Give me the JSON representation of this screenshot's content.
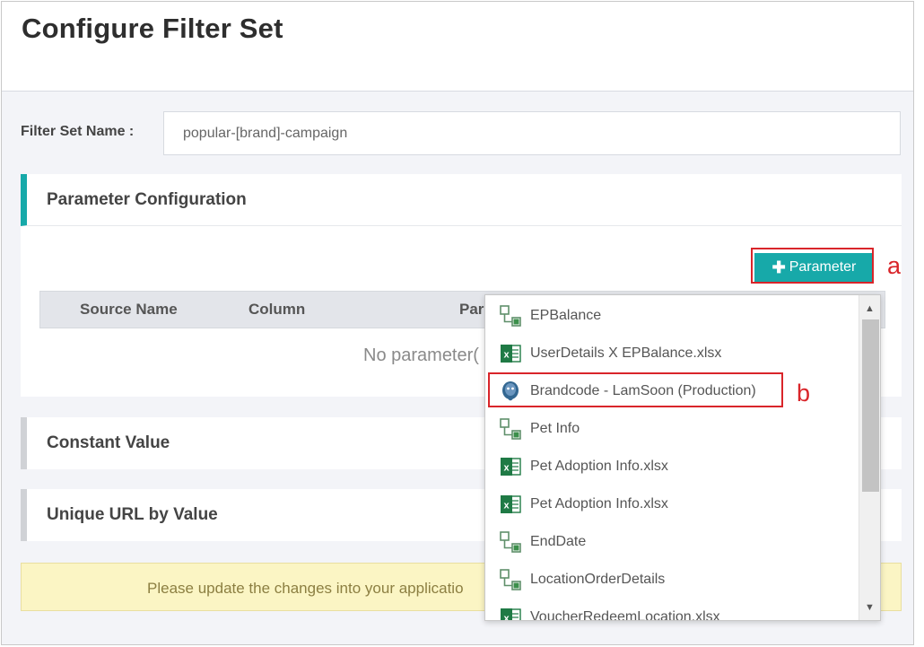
{
  "page": {
    "title": "Configure Filter Set"
  },
  "filter_set": {
    "label": "Filter Set Name :",
    "value": "popular-[brand]-campaign"
  },
  "parameter_config": {
    "title": "Parameter Configuration",
    "add_button_label": "Parameter",
    "columns": [
      "Source Name",
      "Column",
      "Par"
    ],
    "empty_text": "No parameter("
  },
  "constant_value": {
    "title": "Constant Value"
  },
  "unique_url": {
    "title": "Unique URL by Value"
  },
  "notice": {
    "text": "Please update the changes into your applicatio"
  },
  "annotations": {
    "a": "a",
    "b": "b",
    "color": "#d9252a"
  },
  "theme": {
    "accent": "#17a9a9",
    "notice_bg": "#fbf5c4"
  },
  "dropdown": {
    "items": [
      {
        "label": "EPBalance",
        "icon": "dataset-icon"
      },
      {
        "label": "UserDetails X EPBalance.xlsx",
        "icon": "excel-icon"
      },
      {
        "label": "Brandcode - LamSoon (Production)",
        "icon": "postgresql-icon"
      },
      {
        "label": "Pet Info",
        "icon": "dataset-icon"
      },
      {
        "label": "Pet Adoption Info.xlsx",
        "icon": "excel-icon"
      },
      {
        "label": "Pet Adoption Info.xlsx",
        "icon": "excel-icon"
      },
      {
        "label": "EndDate",
        "icon": "dataset-icon"
      },
      {
        "label": "LocationOrderDetails",
        "icon": "dataset-icon"
      },
      {
        "label": "VoucherRedeemLocation.xlsx",
        "icon": "excel-icon"
      }
    ]
  }
}
